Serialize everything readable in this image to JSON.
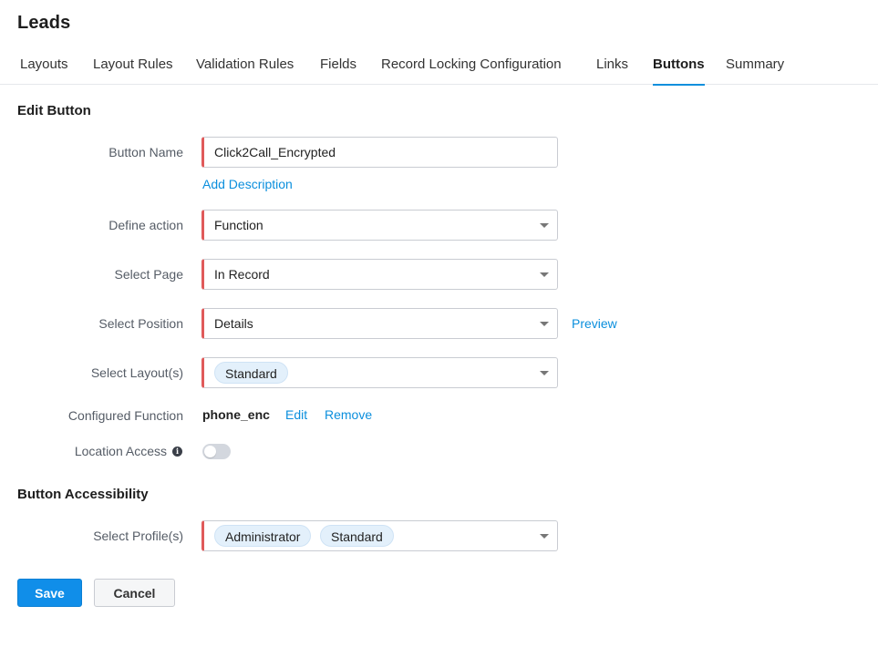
{
  "page": {
    "title": "Leads"
  },
  "tabs": [
    {
      "label": "Layouts",
      "active": false
    },
    {
      "label": "Layout Rules",
      "active": false
    },
    {
      "label": "Validation Rules",
      "active": false
    },
    {
      "label": "Fields",
      "active": false
    },
    {
      "label": "Record Locking Configuration",
      "active": false
    },
    {
      "label": "Links",
      "active": false
    },
    {
      "label": "Buttons",
      "active": true
    },
    {
      "label": "Summary",
      "active": false
    }
  ],
  "edit_button": {
    "section_title": "Edit Button",
    "button_name": {
      "label": "Button Name",
      "value": "Click2Call_Encrypted",
      "add_description": "Add Description"
    },
    "define_action": {
      "label": "Define action",
      "value": "Function"
    },
    "select_page": {
      "label": "Select Page",
      "value": "In Record"
    },
    "select_position": {
      "label": "Select Position",
      "value": "Details",
      "preview": "Preview"
    },
    "select_layouts": {
      "label": "Select Layout(s)",
      "chips": [
        "Standard"
      ]
    },
    "configured_function": {
      "label": "Configured Function",
      "value": "phone_enc",
      "edit": "Edit",
      "remove": "Remove"
    },
    "location_access": {
      "label": "Location Access",
      "enabled": false
    }
  },
  "accessibility": {
    "section_title": "Button Accessibility",
    "select_profiles": {
      "label": "Select Profile(s)",
      "chips": [
        "Administrator",
        "Standard"
      ]
    }
  },
  "actions": {
    "save": "Save",
    "cancel": "Cancel"
  },
  "colors": {
    "accent": "#0b8fdd",
    "required_marker": "#e05a5a",
    "save_button": "#108ee9",
    "chip_bg": "#e3f0fb"
  }
}
